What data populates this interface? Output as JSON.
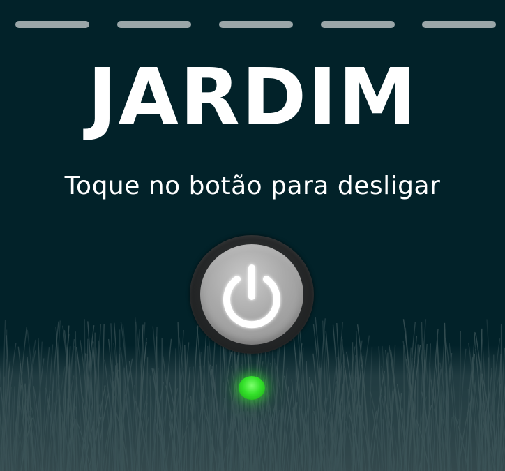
{
  "header": {
    "page_count": 5,
    "page_dashes": [
      "page-1",
      "page-2",
      "page-3",
      "page-4",
      "page-5"
    ]
  },
  "room": {
    "title": "JARDIM"
  },
  "instruction": {
    "text": "Toque no botão para desligar"
  },
  "power_button": {
    "icon": "power-icon",
    "state": "on"
  },
  "status_led": {
    "color": "#3fe336",
    "state": "on"
  },
  "colors": {
    "background": "#022229",
    "text": "#ffffff",
    "page_dash": "#9aa6a8",
    "button_face": "#a9a9a9",
    "button_ring": "#242627",
    "grass": "#2a4247"
  }
}
